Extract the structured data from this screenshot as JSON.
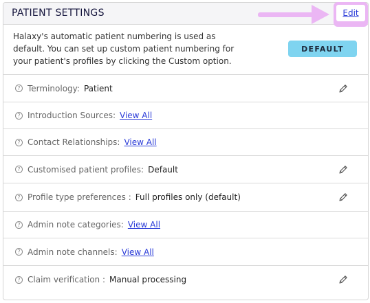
{
  "header": {
    "title": "PATIENT SETTINGS",
    "edit_label": "Edit"
  },
  "intro": {
    "text": "Halaxy's automatic patient numbering is used as default. You can set up custom patient numbering for your patient's profiles by clicking the Custom option.",
    "button_label": "DEFAULT"
  },
  "rows": [
    {
      "label": "Terminology:",
      "value": "Patient",
      "link": "",
      "editable": true
    },
    {
      "label": "Introduction Sources:",
      "value": "",
      "link": "View All",
      "editable": false
    },
    {
      "label": "Contact Relationships:",
      "value": "",
      "link": "View All",
      "editable": false
    },
    {
      "label": "Customised patient profiles:",
      "value": "Default",
      "link": "",
      "editable": true
    },
    {
      "label": "Profile type preferences :",
      "value": "Full profiles only (default)",
      "link": "",
      "editable": true
    },
    {
      "label": "Admin note categories:",
      "value": "",
      "link": "View All",
      "editable": false
    },
    {
      "label": "Admin note channels:",
      "value": "",
      "link": "View All",
      "editable": false
    },
    {
      "label": "Claim verification :",
      "value": "Manual processing",
      "link": "",
      "editable": true
    }
  ],
  "colors": {
    "highlight": "#ebb6f4",
    "link": "#2a3bd8",
    "default_button": "#7fd4f0"
  },
  "icons": {
    "help": "question-circle-icon",
    "edit": "pencil-icon"
  }
}
